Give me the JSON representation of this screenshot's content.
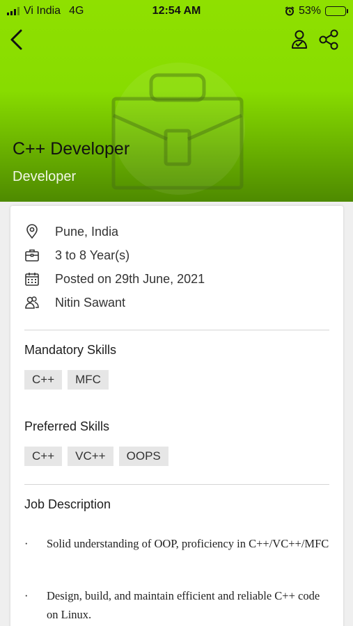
{
  "status_bar": {
    "carrier": "Vi India",
    "network": "4G",
    "time": "12:54 AM",
    "battery_percent": "53%",
    "battery_level": 0.53
  },
  "header": {
    "title": "C++ Developer",
    "subtitle": "Developer",
    "icons": [
      "back-icon",
      "referral-icon",
      "share-icon"
    ]
  },
  "details": {
    "location": "Pune, India",
    "experience": "3 to 8 Year(s)",
    "posted": "Posted on 29th June, 2021",
    "recruiter": "Nitin Sawant"
  },
  "mandatory_skills": {
    "title": "Mandatory Skills",
    "items": [
      "C++",
      "MFC"
    ]
  },
  "preferred_skills": {
    "title": "Preferred Skills",
    "items": [
      "C++",
      "VC++",
      "OOPS"
    ]
  },
  "description": {
    "title": "Job Description",
    "bullet": "·",
    "items": [
      "Solid understanding of OOP, proficiency in C++/VC++/MFC",
      "Design, build, and maintain efficient and reliable C++ code on Linux."
    ]
  },
  "colors": {
    "header_top": "#8fe000",
    "header_bottom": "#4e8a00",
    "chip_bg": "#e6e6e6"
  }
}
